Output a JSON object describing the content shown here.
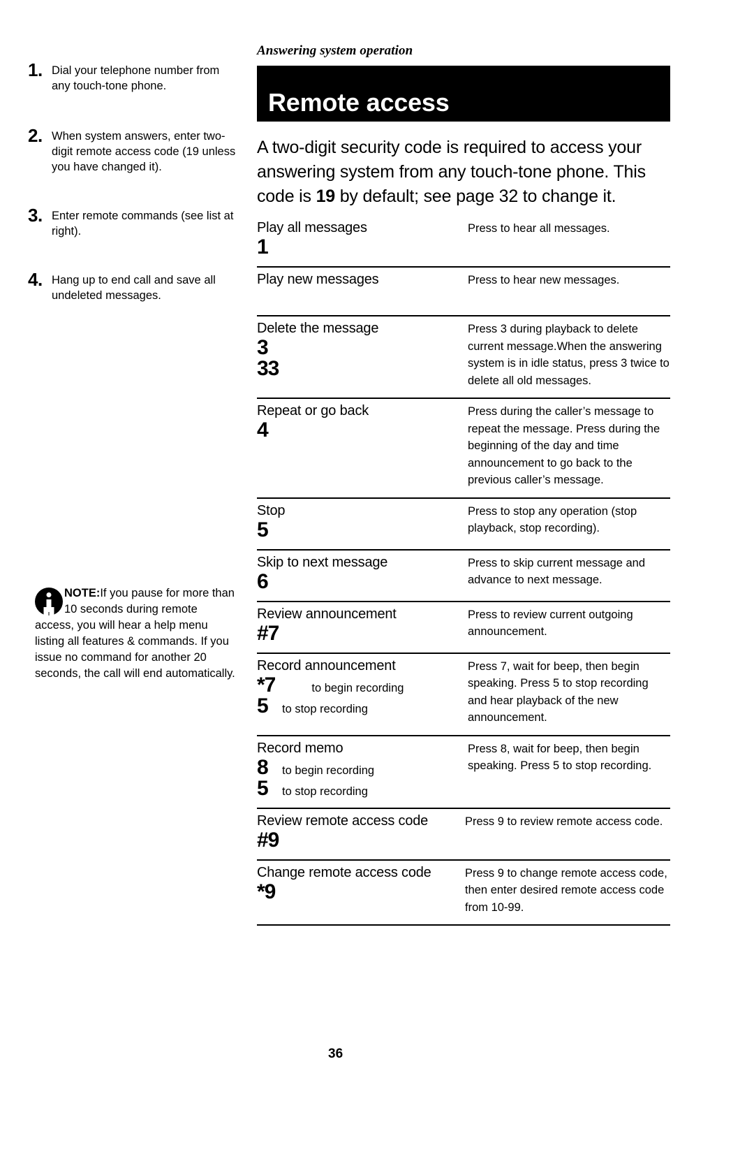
{
  "running_head": "Answering system operation",
  "section_title": "Remote access",
  "intro": {
    "part1": "A two-digit security code is required to access your answering system from any touch-tone phone. This code is ",
    "part2": "19",
    "part3": " by default; see page 32 to change it."
  },
  "steps": [
    {
      "number": "1.",
      "text": "Dial your telephone number from any touch-tone phone."
    },
    {
      "number": "2.",
      "text": "When system answers, enter two-digit remote access code (19 unless you have changed it)."
    },
    {
      "number": "3.",
      "text": "Enter remote commands (see list at right)."
    },
    {
      "number": "4.",
      "text": "Hang up to end call and save all undeleted messages."
    }
  ],
  "note": {
    "label": "NOTE:",
    "text": "If you pause for more than 10 seconds during remote access, you will hear a help menu listing all features & commands. If you issue no command for another 20 seconds, the call will end automatically."
  },
  "commands": [
    {
      "name": "Play all messages",
      "keys": [
        {
          "glyph": "1",
          "caption": ""
        }
      ],
      "description": "Press to hear all messages."
    },
    {
      "name": "Play new messages",
      "keys": [
        {
          "glyph": "",
          "caption": ""
        }
      ],
      "description": "Press to hear new messages."
    },
    {
      "name": "Delete the message",
      "keys": [
        {
          "glyph": "3",
          "caption": ""
        },
        {
          "glyph": "33",
          "caption": ""
        }
      ],
      "description": "Press 3 during playback to delete current message.When the answering system is in idle status, press 3 twice to delete all old messages."
    },
    {
      "name": "Repeat or go back",
      "keys": [
        {
          "glyph": "4",
          "caption": ""
        }
      ],
      "description": "Press during the caller’s message to repeat the message.  Press during the beginning of the day and time announcement to go back to the previous caller’s message."
    },
    {
      "name": "Stop",
      "keys": [
        {
          "glyph": "5",
          "caption": ""
        }
      ],
      "description": "Press to stop any operation (stop playback, stop recording)."
    },
    {
      "name": "Skip to next message",
      "keys": [
        {
          "glyph": "6",
          "caption": ""
        }
      ],
      "description": "Press to skip current message and advance to next message."
    },
    {
      "name": "Review announcement",
      "keys": [
        {
          "glyph": "#7",
          "caption": ""
        }
      ],
      "description": "Press to review current outgoing announcement."
    },
    {
      "name": "Record announcement",
      "keys": [
        {
          "glyph": "*7",
          "caption": "to begin recording"
        },
        {
          "glyph": "5",
          "caption": "to stop recording"
        }
      ],
      "description": "Press   7, wait for beep, then begin speaking. Press 5 to stop recording and hear playback of the new announcement."
    },
    {
      "name": "Record memo",
      "keys": [
        {
          "glyph": "8",
          "caption": "to begin recording"
        },
        {
          "glyph": "5",
          "caption": "to stop recording"
        }
      ],
      "description": "Press 8, wait for beep, then begin speaking. Press 5 to stop recording."
    },
    {
      "name": "Review remote access code",
      "keys": [
        {
          "glyph": "#9",
          "caption": ""
        }
      ],
      "description": "Press   9 to review remote access code."
    },
    {
      "name": "Change remote access code",
      "keys": [
        {
          "glyph": "*9",
          "caption": ""
        }
      ],
      "description": "Press   9 to change remote access code, then enter desired remote access code from 10-99."
    }
  ],
  "page_number": "36"
}
